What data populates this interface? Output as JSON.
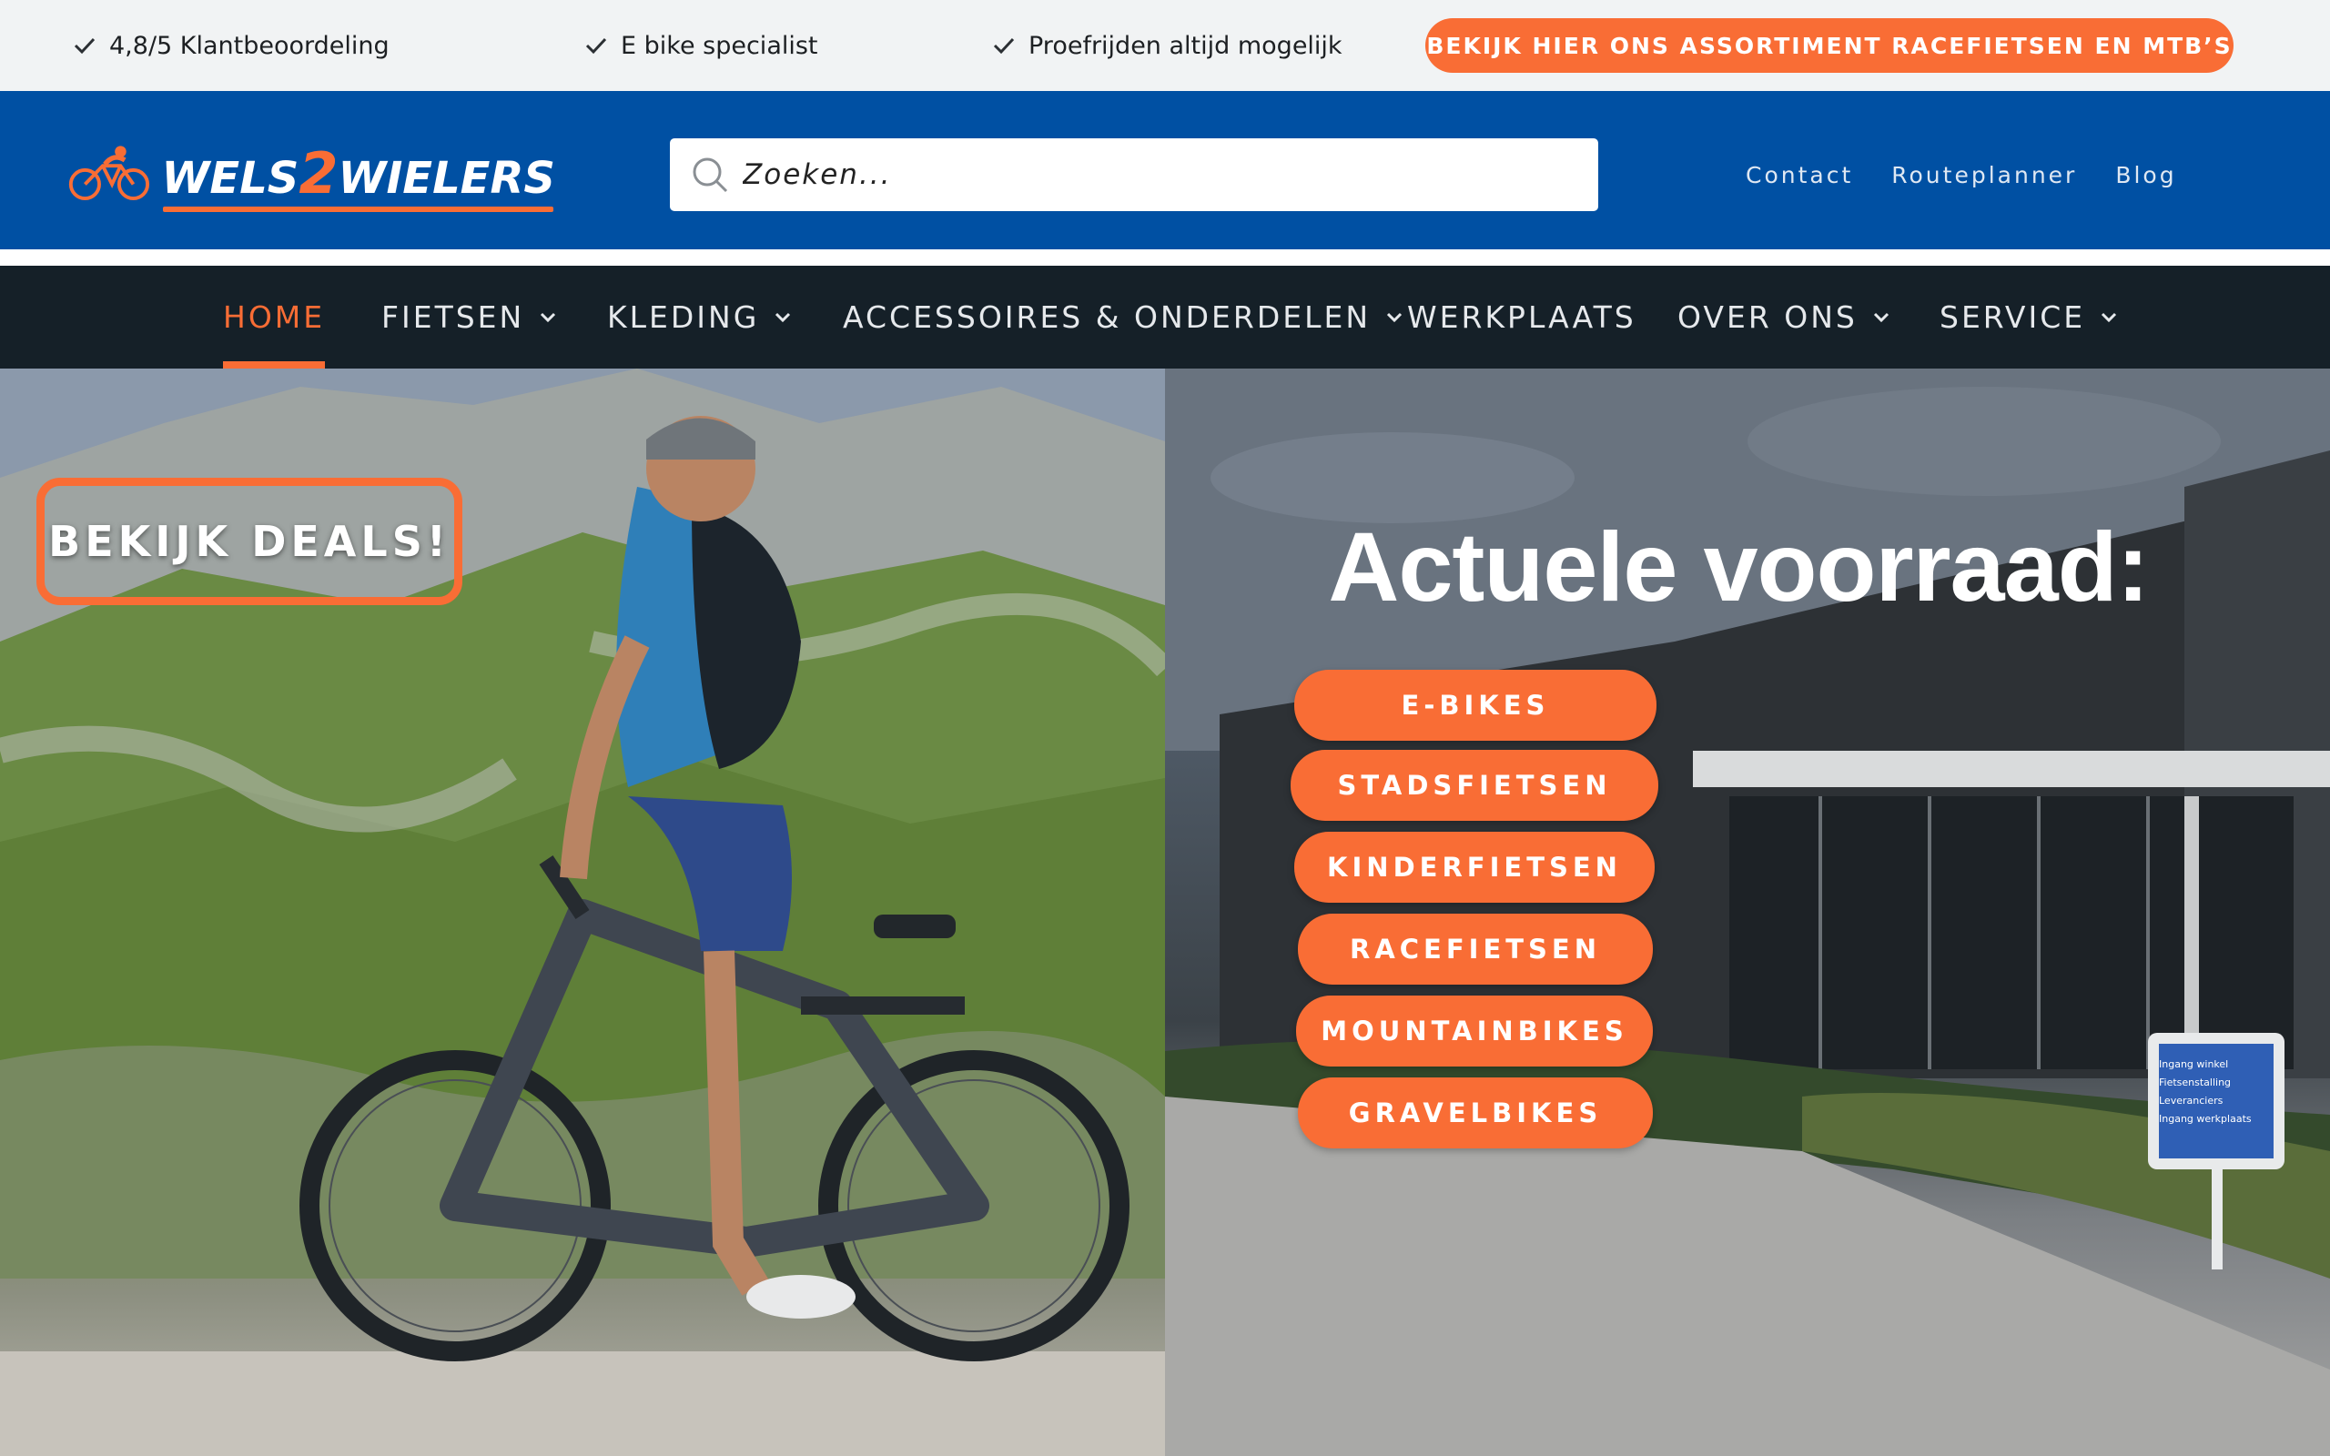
{
  "usp_bar": {
    "items": [
      {
        "text": "4,8/5 Klantbeoordeling",
        "icon": "check-icon"
      },
      {
        "text": "E bike specialist",
        "icon": "check-icon"
      },
      {
        "text": "Proefrijden altijd mogelijk",
        "icon": "check-icon"
      }
    ],
    "promo_button": "BEKIJK HIER ONS ASSORTIMENT RACEFIETSEN EN MTB’S"
  },
  "header": {
    "logo": {
      "part1": "WELS",
      "part2": "2",
      "part3": "WIELERS"
    },
    "search": {
      "placeholder": "Zoeken..."
    },
    "links": [
      "Contact",
      "Routeplanner",
      "Blog"
    ]
  },
  "nav": {
    "items": [
      {
        "label": "HOME",
        "active": true,
        "dropdown": false
      },
      {
        "label": "FIETSEN",
        "dropdown": true
      },
      {
        "label": "KLEDING",
        "dropdown": true
      },
      {
        "label": "ACCESSOIRES & ONDERDELEN",
        "dropdown": true
      },
      {
        "label": "WERKPLAATS",
        "dropdown": false
      },
      {
        "label": "OVER ONS",
        "dropdown": true
      },
      {
        "label": "SERVICE",
        "dropdown": true
      }
    ]
  },
  "hero": {
    "deals_button": "BEKIJK DEALS!",
    "stock_title": "Actuele voorraad:",
    "categories": [
      "E-BIKES",
      "STADSFIETSEN",
      "KINDERFIETSEN",
      "RACEFIETSEN",
      "MOUNTAINBIKES",
      "GRAVELBIKES"
    ],
    "sign_lines": [
      "Ingang winkel",
      "Fietsenstalling",
      "Leveranciers",
      "Ingang werkplaats"
    ]
  },
  "colors": {
    "accent": "#f96d35",
    "header_blue": "#0050a3",
    "nav_dark": "#152028",
    "usp_bg": "#f1f3f4"
  }
}
